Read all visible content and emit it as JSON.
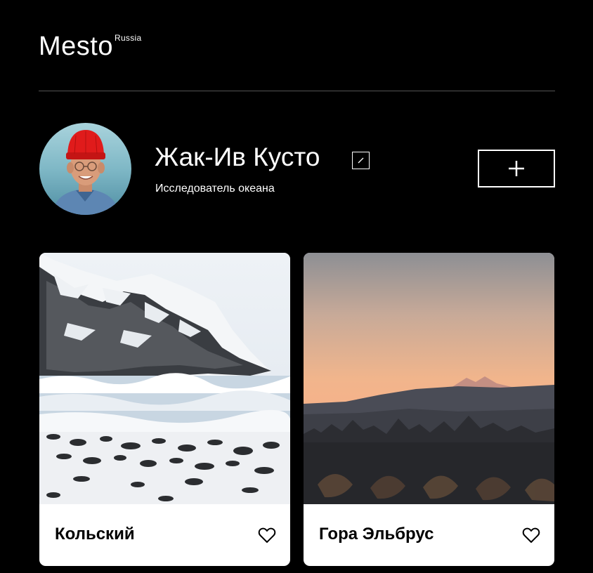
{
  "header": {
    "logo": "Mesto",
    "logo_sup": "Russia"
  },
  "profile": {
    "name": "Жак-Ив Кусто",
    "about": "Исследователь океана",
    "edit_icon": "pencil-icon",
    "add_icon": "plus-icon"
  },
  "cards": [
    {
      "title": "Кольский",
      "like_icon": "heart-outline-icon"
    },
    {
      "title": "Гора Эльбрус",
      "like_icon": "heart-outline-icon"
    }
  ],
  "colors": {
    "background": "#000000",
    "text": "#ffffff",
    "divider": "#545454",
    "card": "#ffffff",
    "card_text": "#000000"
  }
}
